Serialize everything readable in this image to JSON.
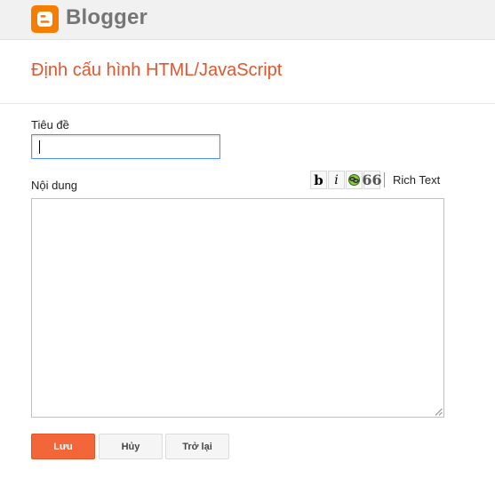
{
  "header": {
    "brand": "Blogger",
    "logo_icon": "blogger-logo-icon",
    "accent": "#f57d00"
  },
  "page": {
    "title": "Định cấu hình HTML/JavaScript",
    "title_color": "#e2552c"
  },
  "form": {
    "title_label": "Tiêu đề",
    "title_value": "",
    "content_label": "Nội dung",
    "content_value": "",
    "toolbar": {
      "bold": "b",
      "italic": "i",
      "link_icon": "link-icon",
      "quote": "66",
      "rich_text": "Rich Text"
    }
  },
  "buttons": {
    "save": "Lưu",
    "cancel": "Hủy",
    "back": "Trở lại",
    "save_color": "#f3663a"
  }
}
